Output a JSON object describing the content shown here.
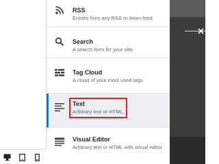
{
  "widgets": [
    {
      "icon": "rss-icon",
      "title": "RSS",
      "description": "Entries from any RSS or Atom feed."
    },
    {
      "icon": "search-icon",
      "title": "Search",
      "description": "A search form for your site."
    },
    {
      "icon": "tag-cloud-icon",
      "title": "Tag Cloud",
      "description": "A cloud of your most used tags."
    },
    {
      "icon": "text-icon",
      "title": "Text",
      "description": "Arbitrary text or HTML."
    },
    {
      "icon": "visual-editor-icon",
      "title": "Visual Editor",
      "description": "Arbitrary text or HTML with visual editor"
    }
  ],
  "selected_widget": "Text",
  "device_buttons": [
    "desktop-icon",
    "tablet-icon",
    "mobile-icon"
  ],
  "colors": {
    "accent": "#2271b1",
    "highlight": "#e02020",
    "selected_bg": "#eceef1",
    "preview_dark": "#3c3c3c"
  }
}
